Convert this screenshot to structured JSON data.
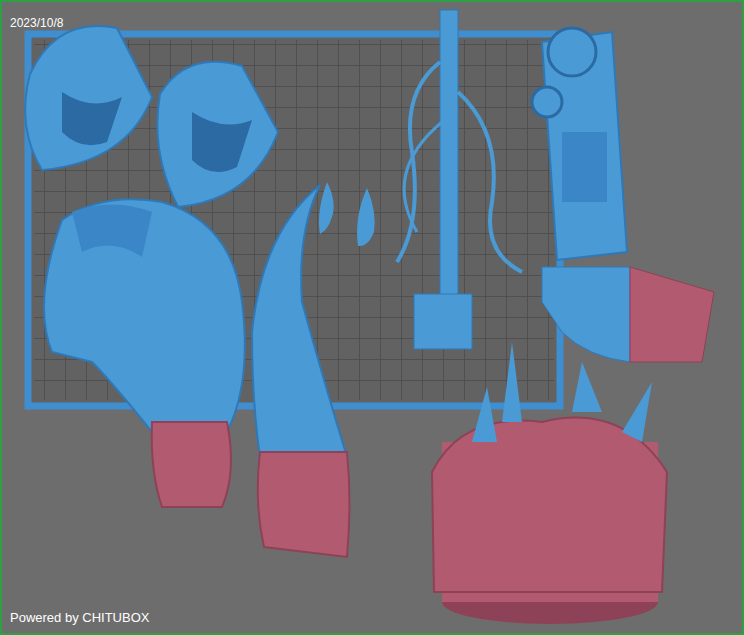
{
  "viewport": {
    "date": "2023/10/8",
    "watermark": "Powered by CHITUBOX"
  }
}
